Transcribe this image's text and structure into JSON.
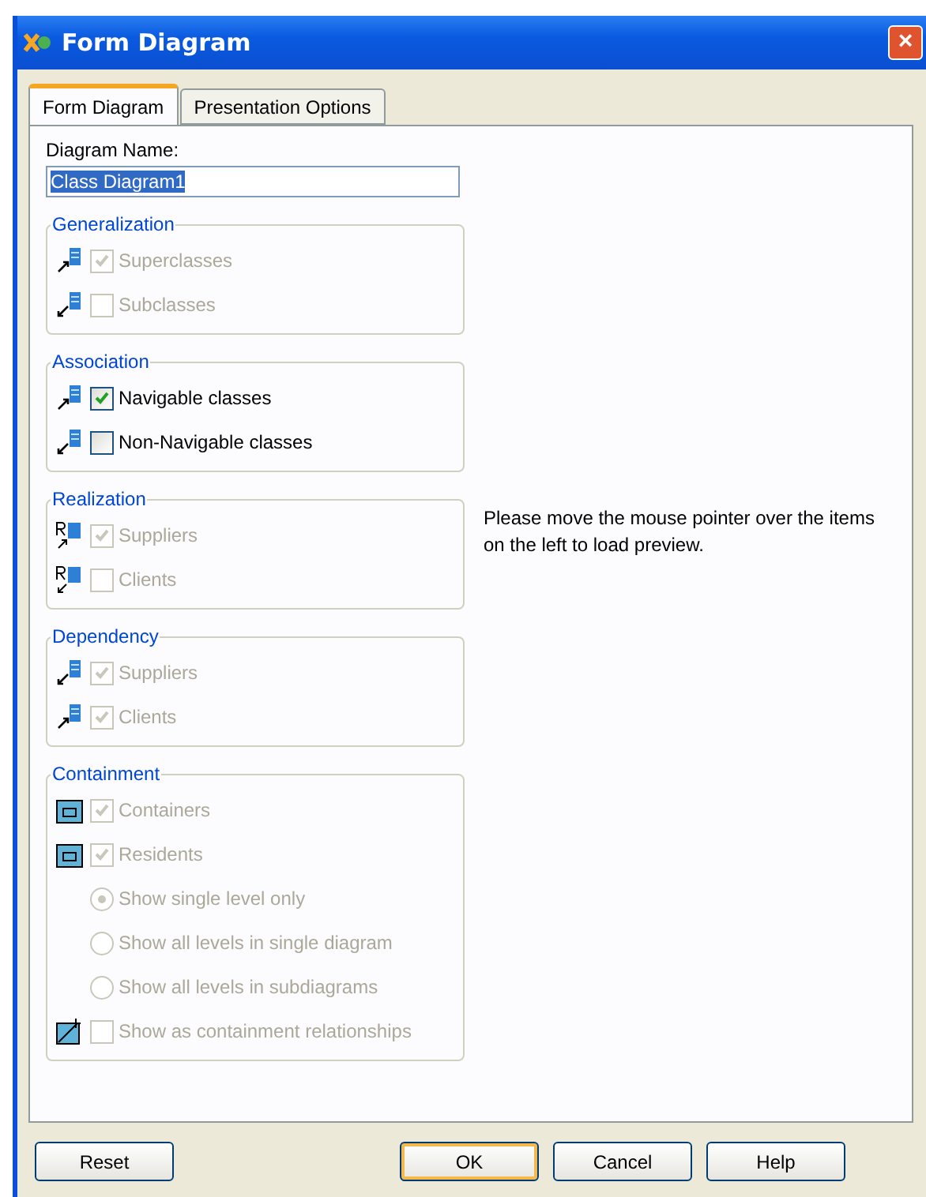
{
  "window": {
    "title": "Form Diagram",
    "close": "×"
  },
  "tabs": [
    {
      "label": "Form Diagram",
      "selected": true
    },
    {
      "label": "Presentation Options",
      "selected": false
    }
  ],
  "diagram_name": {
    "label": "Diagram Name:",
    "value": "Class Diagram1"
  },
  "groups": [
    {
      "title": "Generalization",
      "items": [
        {
          "kind": "checkbox",
          "label": "Superclasses",
          "checked": true,
          "disabled": true
        },
        {
          "kind": "checkbox",
          "label": "Subclasses",
          "checked": false,
          "disabled": true
        }
      ]
    },
    {
      "title": "Association",
      "items": [
        {
          "kind": "checkbox",
          "label": "Navigable classes",
          "checked": true,
          "disabled": false
        },
        {
          "kind": "checkbox",
          "label": "Non-Navigable classes",
          "checked": false,
          "disabled": false
        }
      ]
    },
    {
      "title": "Realization",
      "items": [
        {
          "kind": "checkbox",
          "label": "Suppliers",
          "checked": true,
          "disabled": true
        },
        {
          "kind": "checkbox",
          "label": "Clients",
          "checked": false,
          "disabled": true
        }
      ]
    },
    {
      "title": "Dependency",
      "items": [
        {
          "kind": "checkbox",
          "label": "Suppliers",
          "checked": true,
          "disabled": true
        },
        {
          "kind": "checkbox",
          "label": "Clients",
          "checked": true,
          "disabled": true
        }
      ]
    },
    {
      "title": "Containment",
      "items": [
        {
          "kind": "checkbox",
          "label": "Containers",
          "checked": true,
          "disabled": true
        },
        {
          "kind": "checkbox",
          "label": "Residents",
          "checked": true,
          "disabled": true
        },
        {
          "kind": "radio",
          "label": "Show single level only",
          "selected": true,
          "disabled": true
        },
        {
          "kind": "radio",
          "label": "Show all levels in single diagram",
          "selected": false,
          "disabled": true
        },
        {
          "kind": "radio",
          "label": "Show all levels in subdiagrams",
          "selected": false,
          "disabled": true
        },
        {
          "kind": "checkbox",
          "label": "Show as containment relationships",
          "checked": false,
          "disabled": true
        }
      ]
    }
  ],
  "preview_hint": "Please move the mouse pointer over the items on the left to load preview.",
  "buttons": [
    {
      "label": "Reset",
      "default": false
    },
    {
      "label": "OK",
      "default": true
    },
    {
      "label": "Cancel",
      "default": false
    },
    {
      "label": "Help",
      "default": false
    }
  ]
}
